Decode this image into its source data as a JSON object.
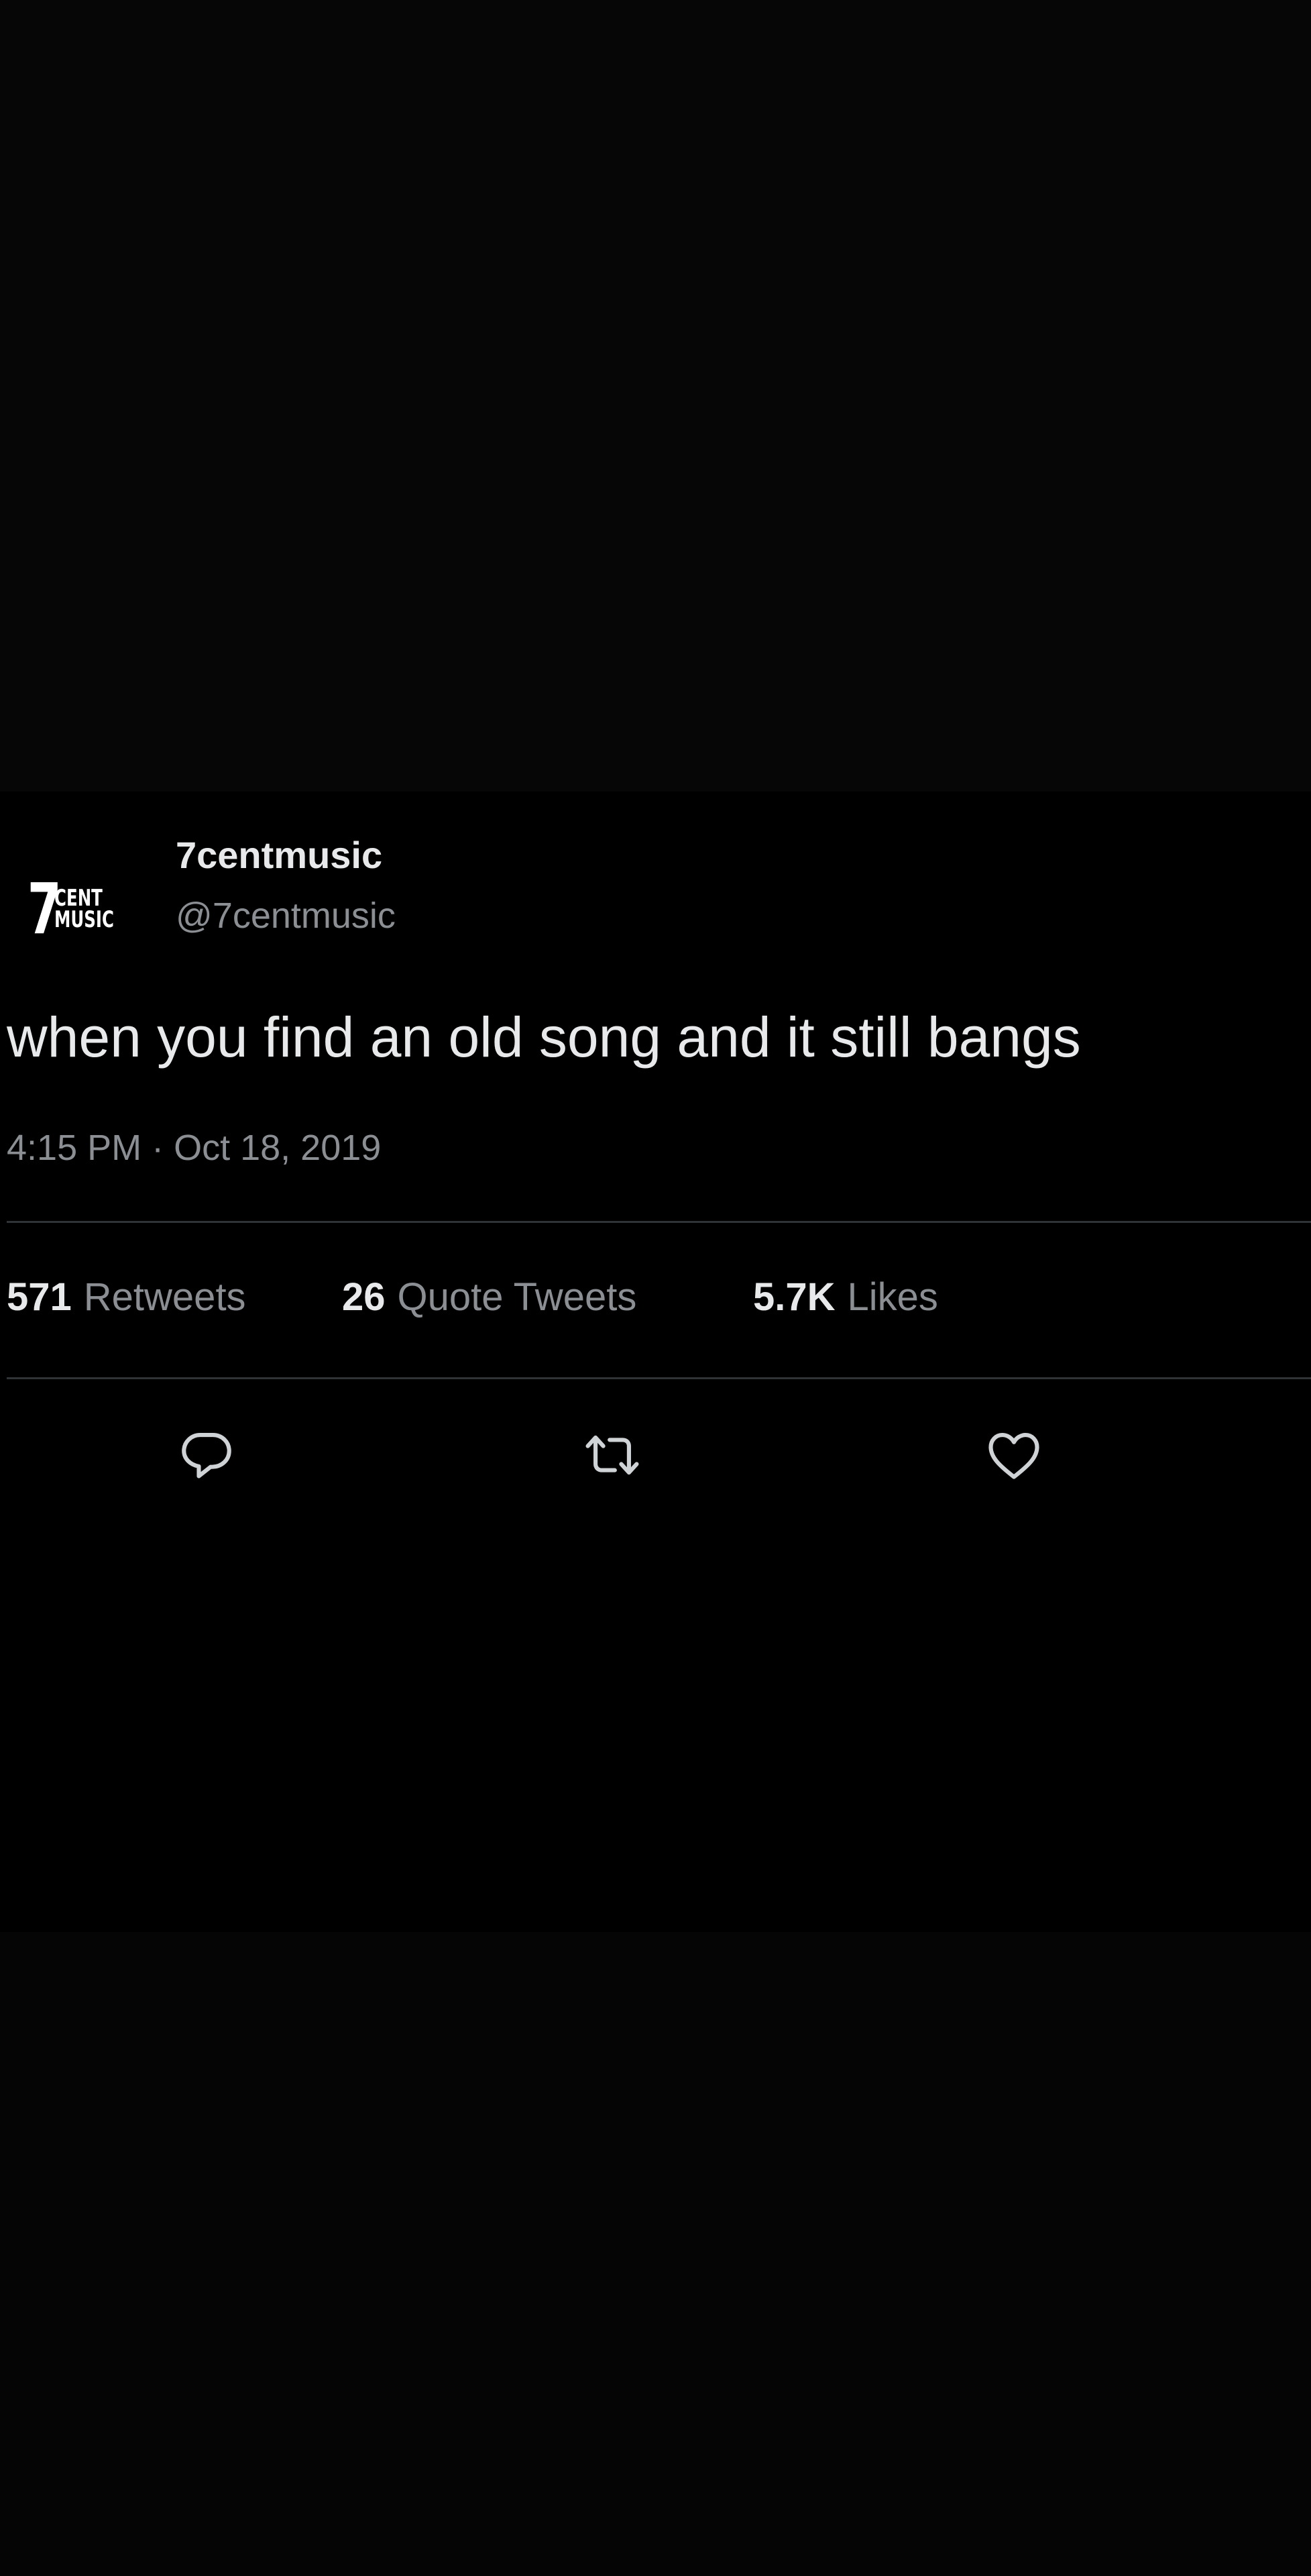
{
  "tweet": {
    "avatar": {
      "logo_number": "7",
      "logo_line1": "CENT",
      "logo_line2": "MUSIC"
    },
    "display_name": "7centmusic",
    "handle": "@7centmusic",
    "text": "when you find an old song and it still bangs",
    "timestamp": "4:15 PM · Oct 18, 2019",
    "stats": {
      "retweets_count": "571",
      "retweets_label": "Retweets",
      "quotes_count": "26",
      "quotes_label": "Quote Tweets",
      "likes_count": "5.7K",
      "likes_label": "Likes"
    },
    "actions": {
      "reply_icon": "reply-icon",
      "retweet_icon": "retweet-icon",
      "like_icon": "heart-icon"
    }
  },
  "colors": {
    "background": "#000000",
    "primary_text": "#e7e9ea",
    "secondary_text": "#8b8f94",
    "divider": "#2f3336"
  }
}
